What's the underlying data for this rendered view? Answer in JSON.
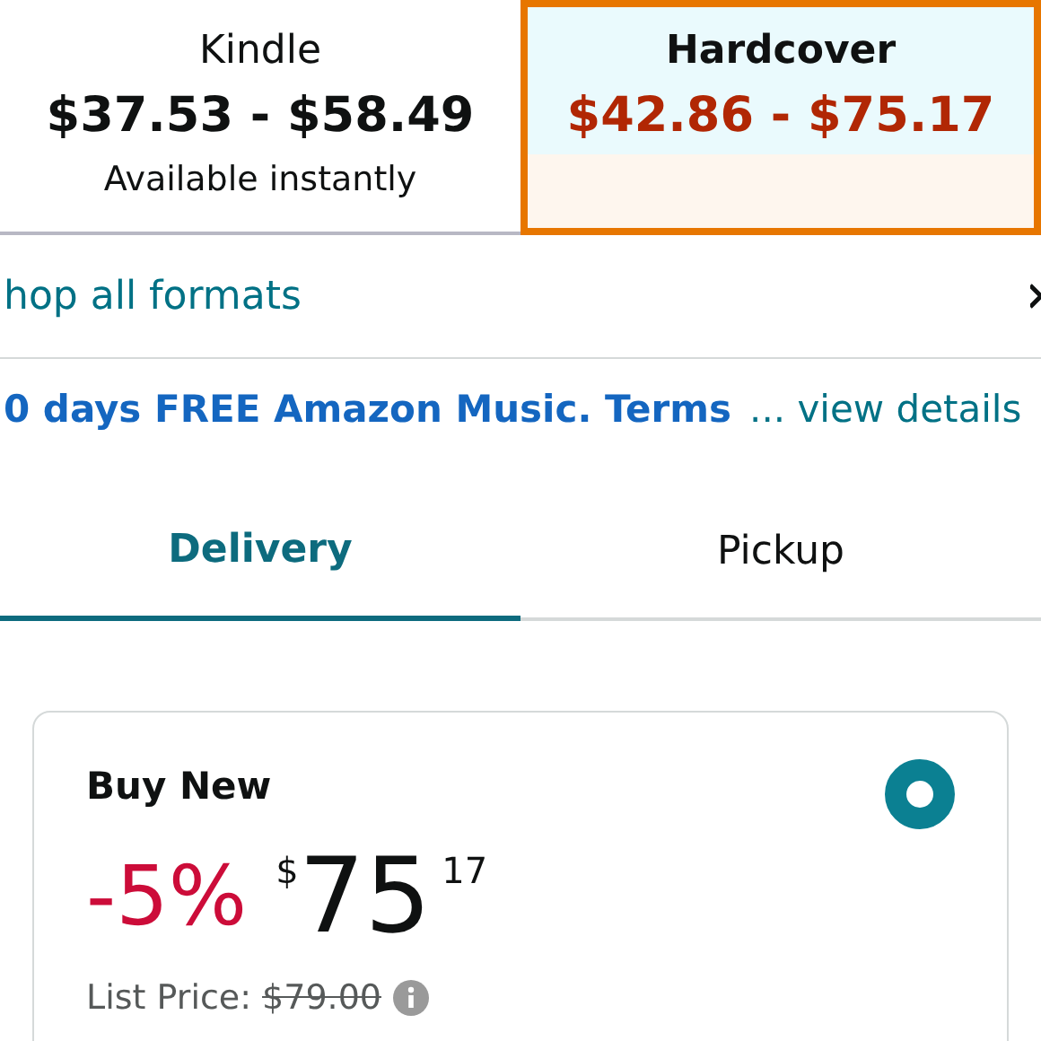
{
  "formats": [
    {
      "name": "Kindle",
      "price": "$37.53 - $58.49",
      "note": "Available instantly",
      "selected": false
    },
    {
      "name": "Hardcover",
      "price": "$42.86 - $75.17",
      "selected": true
    }
  ],
  "shop_all": {
    "label": "hop all formats"
  },
  "promo": {
    "text": "0 days FREE Amazon Music. Terms",
    "link": "... view details"
  },
  "tabs": [
    {
      "label": "Delivery",
      "selected": true
    },
    {
      "label": "Pickup",
      "selected": false
    }
  ],
  "offer": {
    "title": "Buy New",
    "selected": true,
    "discount": "-5%",
    "currency": "$",
    "whole": "75",
    "fraction": "17",
    "list_price_label": "List Price:",
    "list_price": "$79.00"
  }
}
